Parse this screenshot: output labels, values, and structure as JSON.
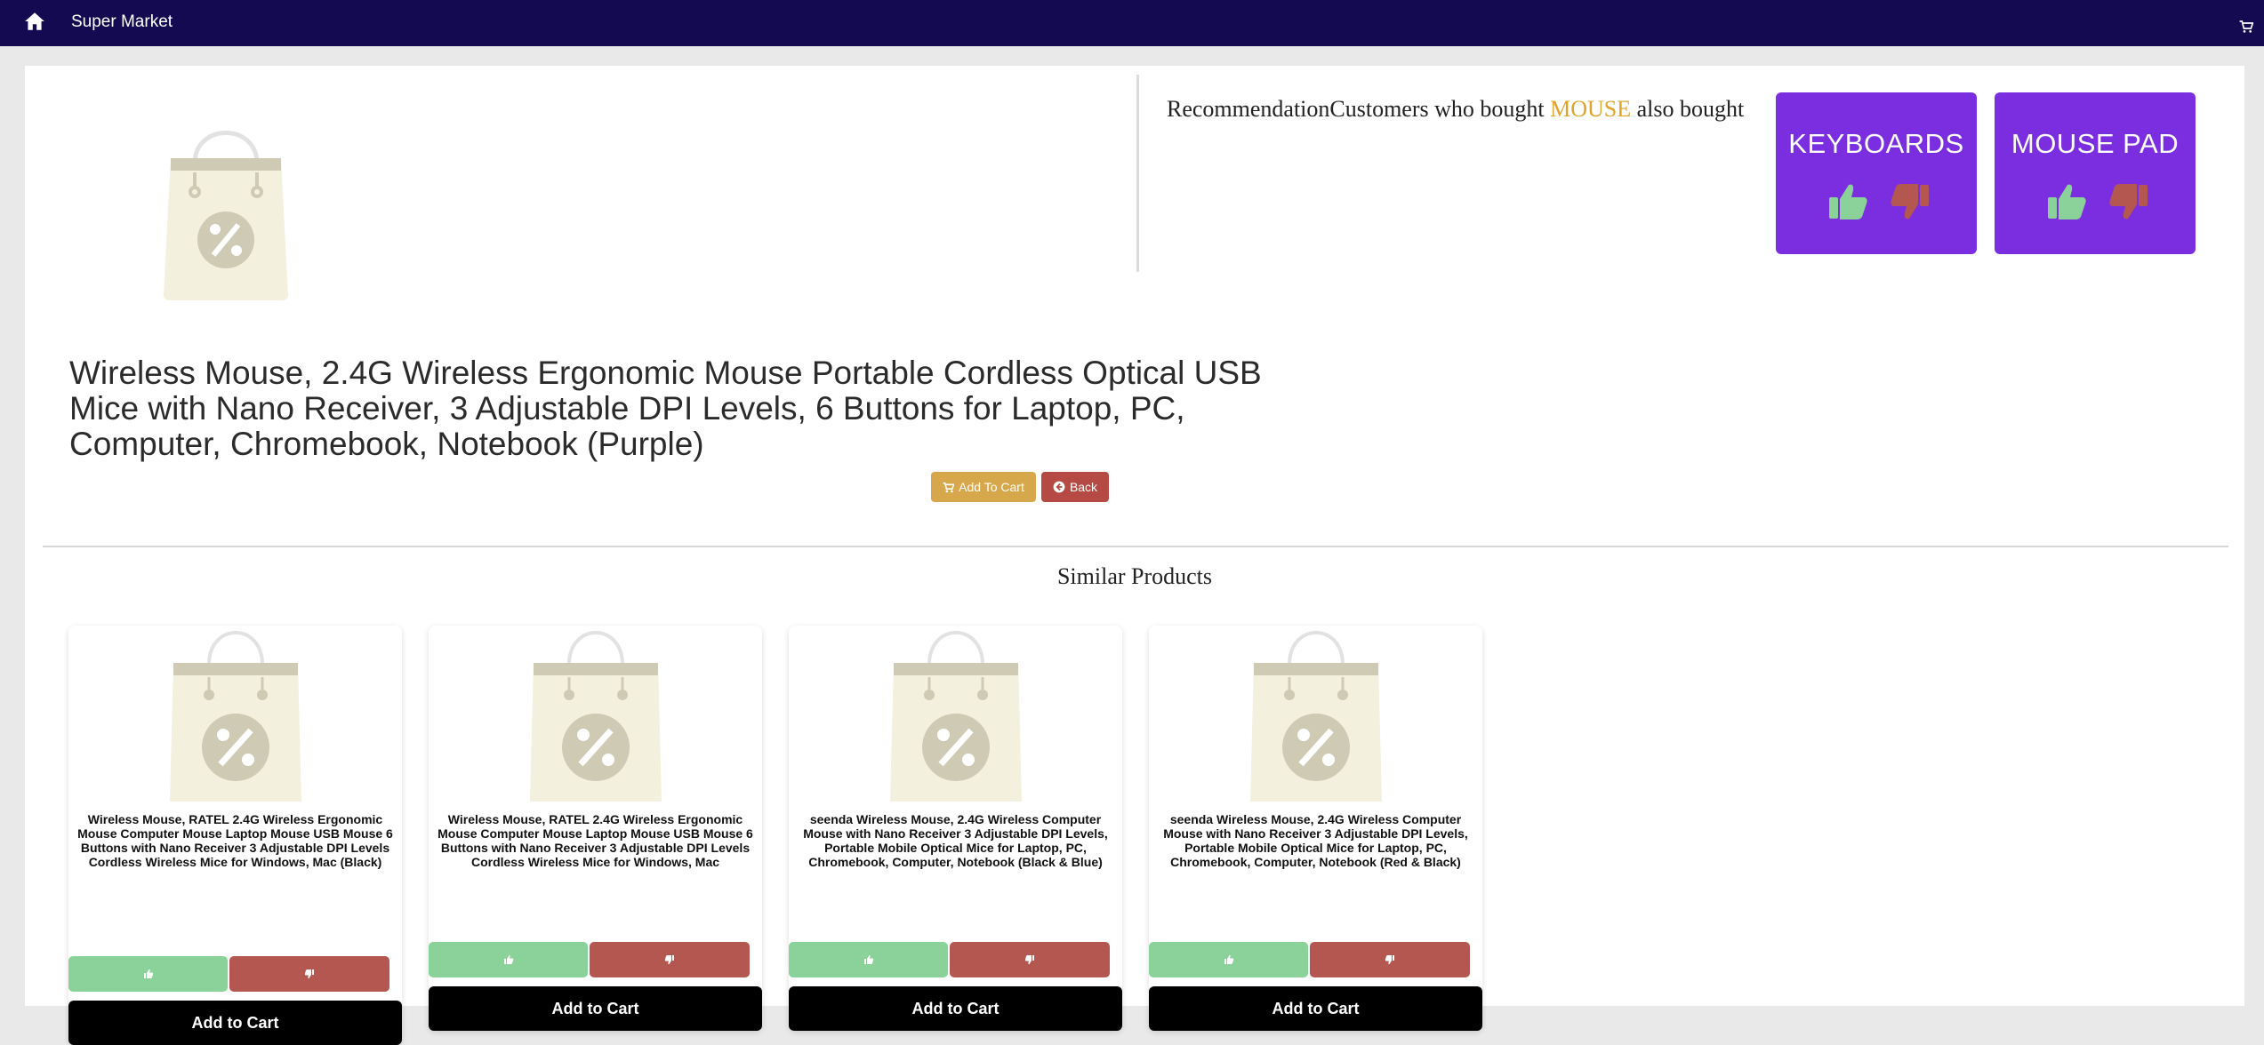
{
  "navbar": {
    "brand": "Super Market",
    "home_icon": "home-icon",
    "cart_icon": "cart-icon",
    "background": "#130a52"
  },
  "product": {
    "title": "Wireless Mouse, 2.4G Wireless Ergonomic Mouse Portable Cordless Optical USB Mice with Nano Receiver, 3 Adjustable DPI Levels, 6 Buttons for Laptop, PC, Computer, Chromebook, Notebook (Purple)",
    "image_icon": "shopping-bag-percent-icon",
    "add_to_cart_label": "Add To Cart",
    "back_label": "Back"
  },
  "recommendation": {
    "prefix": "RecommendationCustomers who bought ",
    "keyword": "MOUSE",
    "suffix": " also bought",
    "keyword_color": "#e0a42c",
    "cards": [
      {
        "label": "KEYBOARDS"
      },
      {
        "label": "MOUSE PAD"
      }
    ],
    "card_color": "#7a2ee0"
  },
  "similar": {
    "heading": "Similar Products",
    "items": [
      {
        "name": "Wireless Mouse, RATEL 2.4G Wireless Ergonomic Mouse Computer Mouse Laptop Mouse USB Mouse 6 Buttons with Nano Receiver 3 Adjustable DPI Levels Cordless Wireless Mice for Windows, Mac (Black)",
        "add_label": "Add to Cart"
      },
      {
        "name": "Wireless Mouse, RATEL 2.4G Wireless Ergonomic Mouse Computer Mouse Laptop Mouse USB Mouse 6 Buttons with Nano Receiver 3 Adjustable DPI Levels Cordless Wireless Mice for Windows, Mac",
        "add_label": "Add to Cart"
      },
      {
        "name": "seenda Wireless Mouse, 2.4G Wireless Computer Mouse with Nano Receiver 3 Adjustable DPI Levels, Portable Mobile Optical Mice for Laptop, PC, Chromebook, Computer, Notebook (Black & Blue)",
        "add_label": "Add to Cart"
      },
      {
        "name": "seenda Wireless Mouse, 2.4G Wireless Computer Mouse with Nano Receiver 3 Adjustable DPI Levels, Portable Mobile Optical Mice for Laptop, PC, Chromebook, Computer, Notebook (Red & Black)",
        "add_label": "Add to Cart"
      }
    ],
    "like_color": "#8ad29a",
    "dislike_color": "#b55751"
  }
}
